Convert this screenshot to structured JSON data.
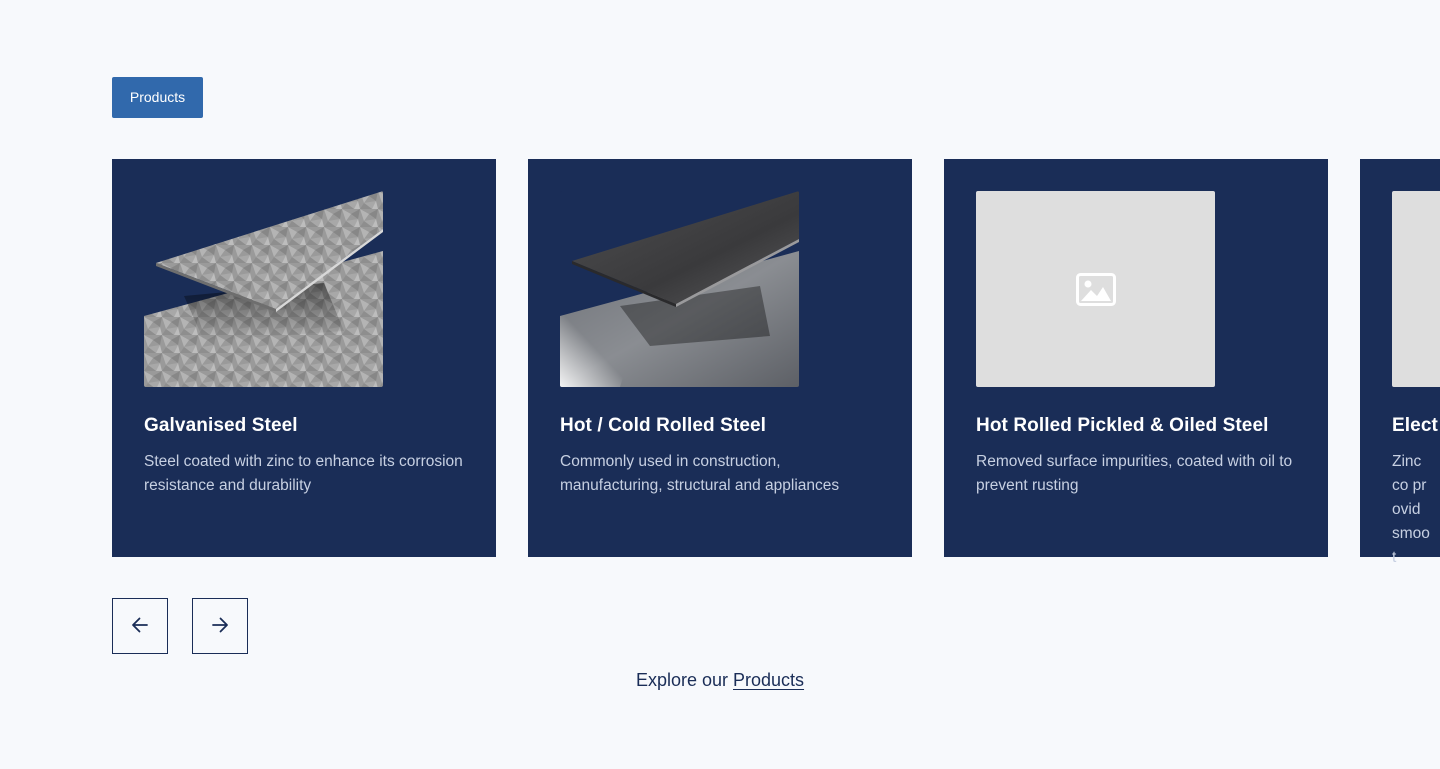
{
  "section": {
    "tag_label": "Products"
  },
  "products": [
    {
      "title": "Galvanised Steel",
      "description": "Steel coated with zinc to enhance its corrosion resistance and  durability",
      "image": "galvanised-steel-sheet"
    },
    {
      "title": "Hot / Cold Rolled Steel",
      "description": "Commonly used in construction, manufacturing, structural and appliances",
      "image": "rolled-steel-sheet"
    },
    {
      "title": "Hot Rolled Pickled & Oiled Steel",
      "description": "Removed surface impurities, coated with oil to prevent rusting",
      "image": "image-placeholder-icon"
    },
    {
      "title": "Elect",
      "description": "Zinc co provid smoot",
      "image": "image-placeholder-icon"
    }
  ],
  "controls": {
    "prev_icon": "arrow-left-icon",
    "next_icon": "arrow-right-icon"
  },
  "footer": {
    "explore_prefix": "Explore our ",
    "explore_link": "Products"
  },
  "colors": {
    "background": "#f7f9fc",
    "card": "#1a2d57",
    "accent": "#3169ac",
    "placeholder": "#dedede"
  }
}
